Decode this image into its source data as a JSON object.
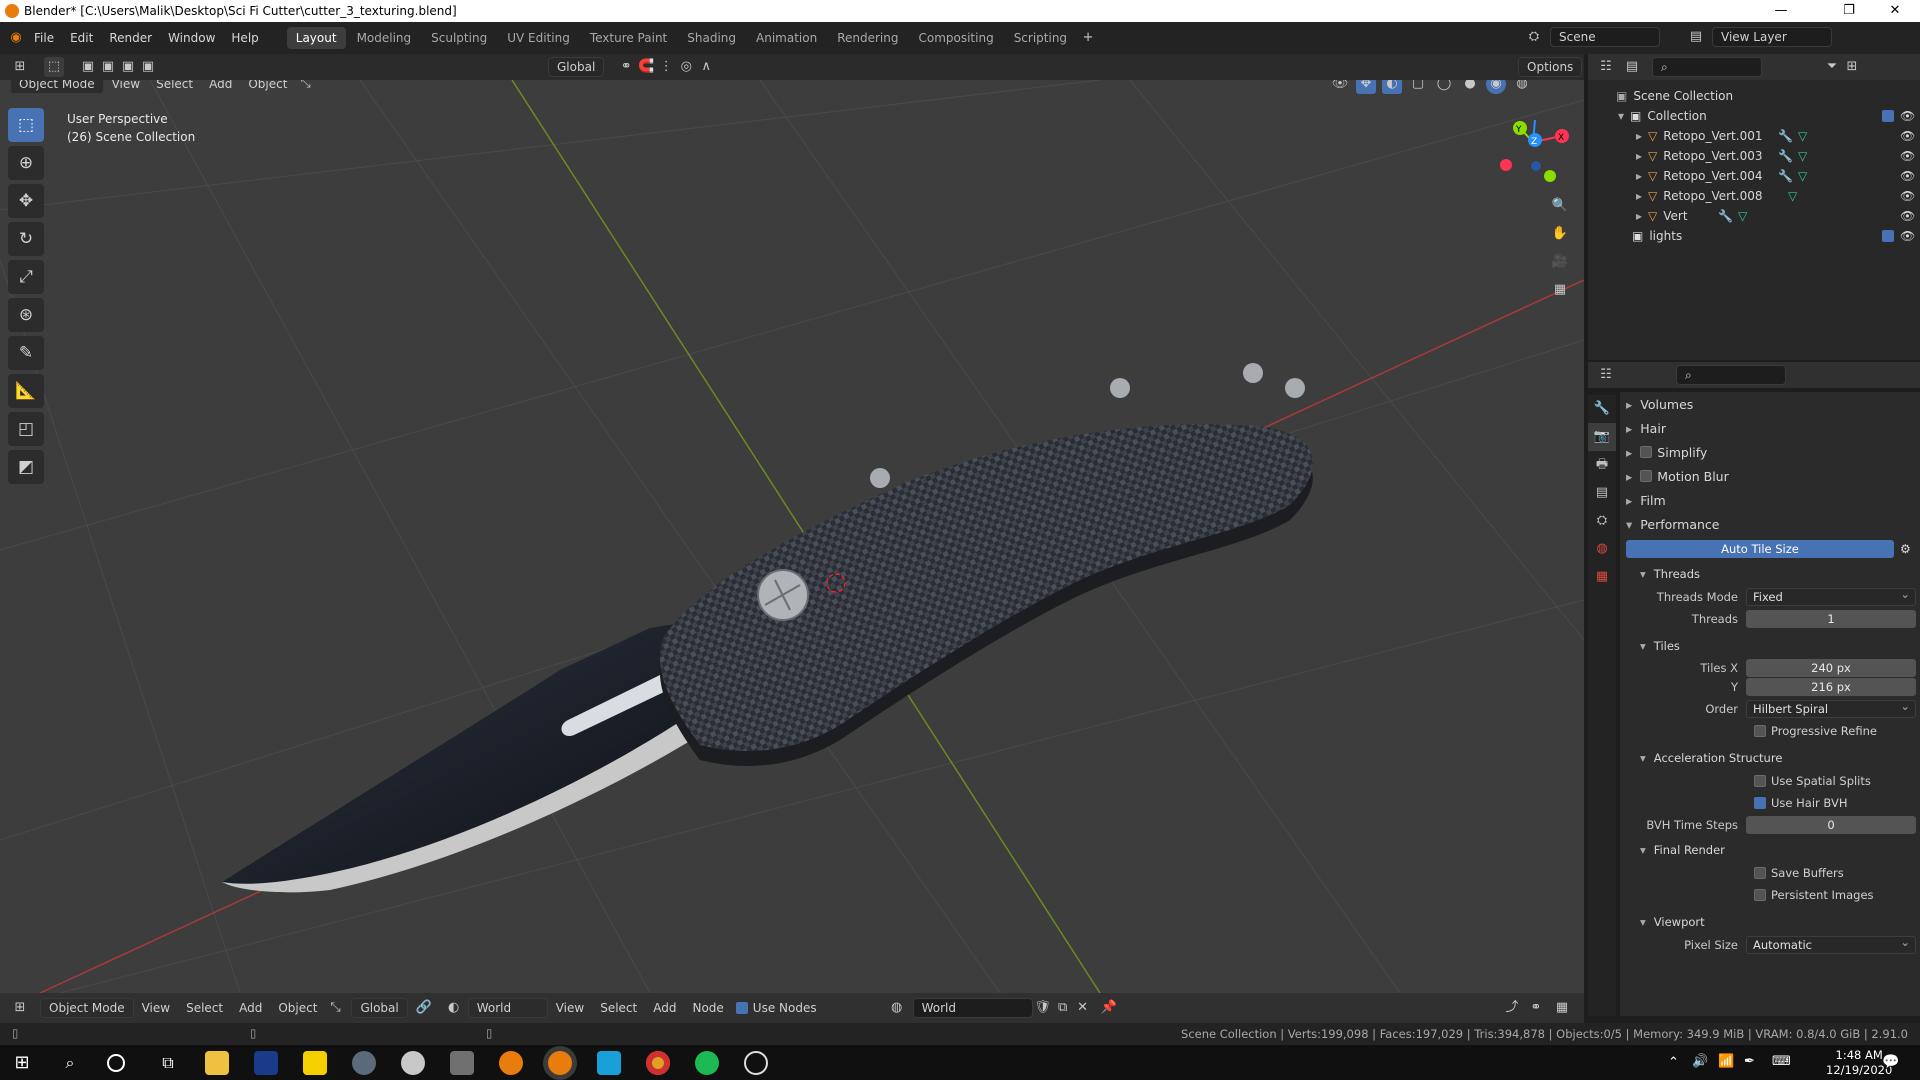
{
  "window": {
    "title": "Blender* [C:\\Users\\Malik\\Desktop\\Sci Fi Cutter\\cutter_3_texturing.blend]"
  },
  "menu": {
    "file": "File",
    "edit": "Edit",
    "render": "Render",
    "window": "Window",
    "help": "Help"
  },
  "workspaces": [
    "Layout",
    "Modeling",
    "Sculpting",
    "UV Editing",
    "Texture Paint",
    "Shading",
    "Animation",
    "Rendering",
    "Compositing",
    "Scripting"
  ],
  "top_right": {
    "scene": "Scene",
    "view_layer": "View Layer"
  },
  "viewport_header": {
    "mode": "Object Mode",
    "view": "View",
    "select": "Select",
    "add": "Add",
    "object": "Object",
    "orientation": "Global",
    "options": "Options"
  },
  "viewport": {
    "perspective": "User Perspective",
    "collection": "(26) Scene Collection"
  },
  "gizmo": {
    "x": "X",
    "y": "Y",
    "z": "Z"
  },
  "outliner": {
    "root": "Scene Collection",
    "collection": "Collection",
    "items": [
      "Retopo_Vert.001",
      "Retopo_Vert.003",
      "Retopo_Vert.004",
      "Retopo_Vert.008",
      "Vert"
    ],
    "lights": "lights"
  },
  "properties": {
    "sections": [
      "Volumes",
      "Hair",
      "Simplify",
      "Motion Blur",
      "Film",
      "Performance"
    ],
    "auto_tile": "Auto Tile Size",
    "threads": {
      "header": "Threads",
      "mode_label": "Threads Mode",
      "mode_value": "Fixed",
      "count_label": "Threads",
      "count_value": "1"
    },
    "tiles": {
      "header": "Tiles",
      "x_label": "Tiles X",
      "x_value": "240 px",
      "y_label": "Y",
      "y_value": "216 px",
      "order_label": "Order",
      "order_value": "Hilbert Spiral",
      "progressive": "Progressive Refine"
    },
    "accel": {
      "header": "Acceleration Structure",
      "spatial": "Use Spatial Splits",
      "hair_bvh": "Use Hair BVH",
      "bvh_label": "BVH Time Steps",
      "bvh_value": "0"
    },
    "final": {
      "header": "Final Render",
      "save_buffers": "Save Buffers",
      "persistent": "Persistent Images"
    },
    "vp": {
      "header": "Viewport",
      "pixel_label": "Pixel Size",
      "pixel_value": "Automatic"
    }
  },
  "node_header": {
    "mode": "Object Mode",
    "view": "View",
    "select": "Select",
    "add": "Add",
    "object": "Object",
    "orientation": "Global",
    "world": "World",
    "view2": "View",
    "select2": "Select",
    "add2": "Add",
    "node": "Node",
    "use_nodes": "Use Nodes",
    "world_name": "World"
  },
  "status": {
    "text": "Scene Collection | Verts:199,098 | Faces:197,029 | Tris:394,878 | Objects:0/5 | Memory: 349.9 MiB | VRAM: 0.8/4.0 GiB | 2.91.0"
  },
  "taskbar": {
    "time": "1:48 AM",
    "date": "12/19/2020"
  },
  "colors": {
    "accent": "#4772b3",
    "orange": "#e87d0d",
    "x_axis": "#ff3352",
    "y_axis": "#8bdc00",
    "z_axis": "#2890ff"
  }
}
